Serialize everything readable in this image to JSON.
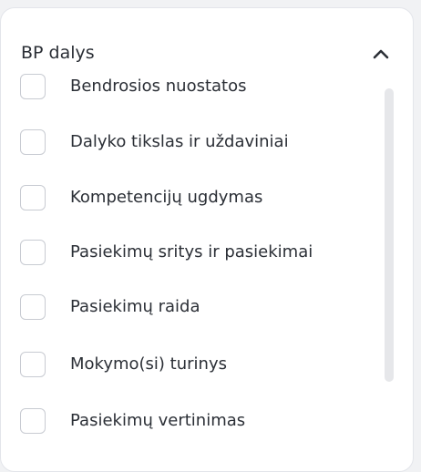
{
  "section": {
    "title": "BP dalys",
    "items": [
      {
        "label": "Bendrosios nuostatos",
        "checked": false
      },
      {
        "label": "Dalyko tikslas ir uždaviniai",
        "checked": false
      },
      {
        "label": "Kompetencijų ugdymas",
        "checked": false
      },
      {
        "label": "Pasiekimų sritys ir pasiekimai",
        "checked": false
      },
      {
        "label": "Pasiekimų raida",
        "checked": false
      },
      {
        "label": "Mokymo(si) turinys",
        "checked": false
      },
      {
        "label": "Pasiekimų vertinimas",
        "checked": false
      }
    ]
  }
}
